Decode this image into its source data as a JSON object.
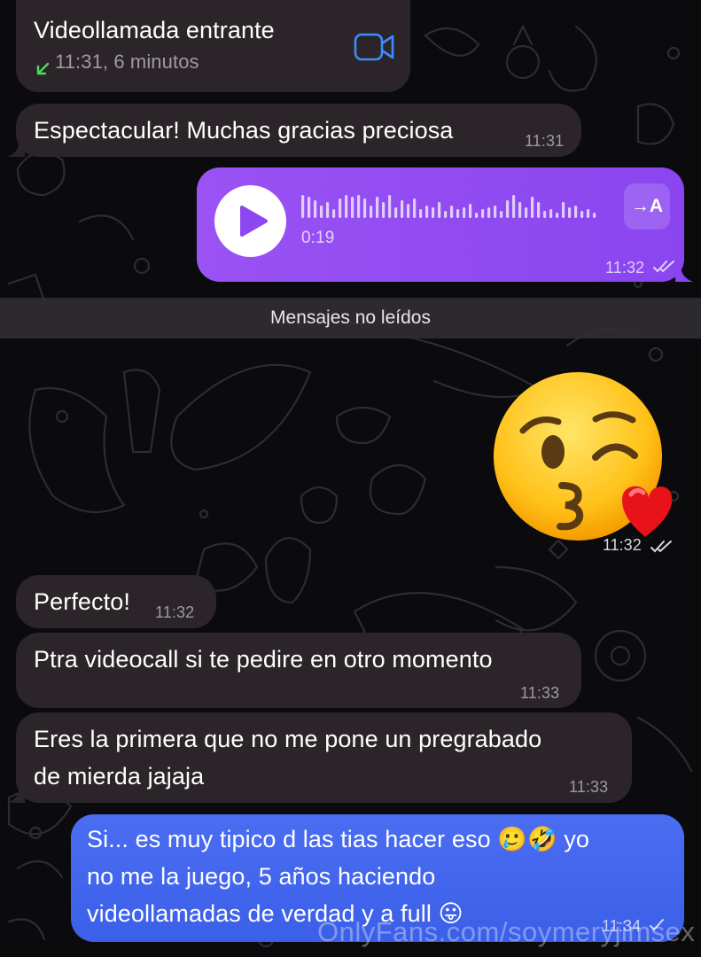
{
  "messages": {
    "call": {
      "title": "Videollamada entrante",
      "meta": "11:31, 6 minutos",
      "direction_icon": "arrow-incoming-icon",
      "action_icon": "video-camera-icon"
    },
    "msg1": {
      "text": "Espectacular! Muchas gracias preciosa",
      "time": "11:31"
    },
    "voice": {
      "duration": "0:19",
      "time": "11:32",
      "transcribe_label": "→A"
    },
    "unread_divider": "Mensajes no leídos",
    "sticker": {
      "emoji": "😘",
      "time": "11:32"
    },
    "msg2": {
      "text": "Perfecto!",
      "time": "11:32"
    },
    "msg3": {
      "text": "Ptra videocall si te pedire en otro momento",
      "time": "11:33"
    },
    "msg4": {
      "line1": "Eres la primera que no me pone un pregrabado",
      "line2": "de mierda jajaja",
      "time": "11:33"
    },
    "msg5": {
      "line1": "Si... es muy tipico d las tias hacer eso 🥲🤣 yo",
      "line2": "no me la juego, 5 años haciendo",
      "line3": "videollamadas de verdad y a full 😛",
      "time": "11:34"
    }
  },
  "watermark": "OnlyFans.com/soymeryjimsex",
  "colors": {
    "incoming_bubble": "#2b2529",
    "voice_bubble": "#9a52f4",
    "outgoing_bubble": "#4a6df2",
    "background": "#0b0b0d",
    "accent_blue": "#3d8bff",
    "accent_green": "#4cd964"
  }
}
